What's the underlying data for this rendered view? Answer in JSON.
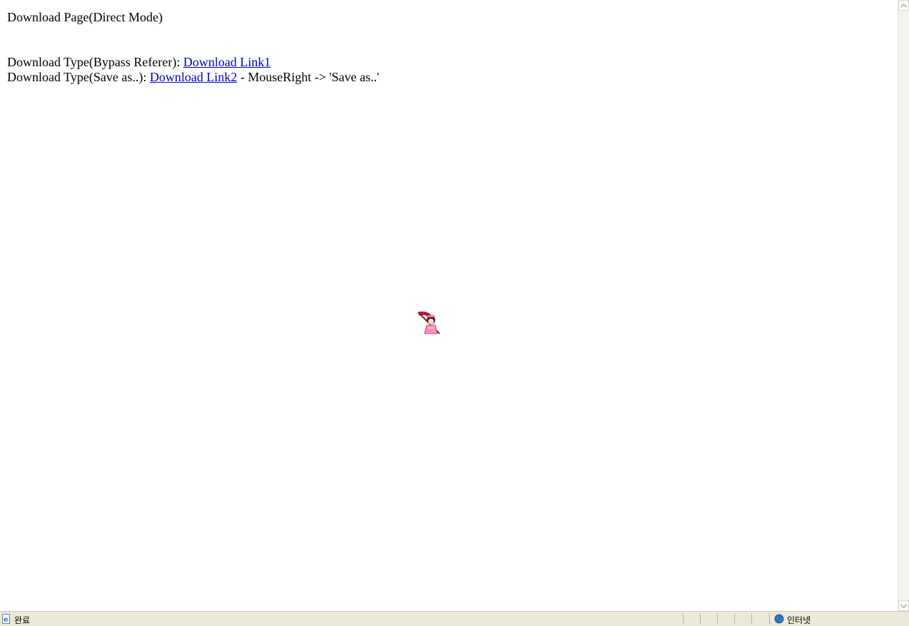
{
  "page": {
    "title": "Download Page(Direct Mode)",
    "line1_prefix": "Download Type(Bypass Referer): ",
    "link1": "Download Link1",
    "line2_prefix": "Download Type(Save as..): ",
    "link2": "Download Link2",
    "line2_suffix": " - MouseRight -> 'Save as..'"
  },
  "statusbar": {
    "status_text": "완료",
    "zone_text": "인터넷",
    "status_icon": "ie-page-icon",
    "zone_icon": "globe-icon"
  },
  "colors": {
    "link": "#0000cc",
    "statusbar_bg": "#ece9d8"
  }
}
